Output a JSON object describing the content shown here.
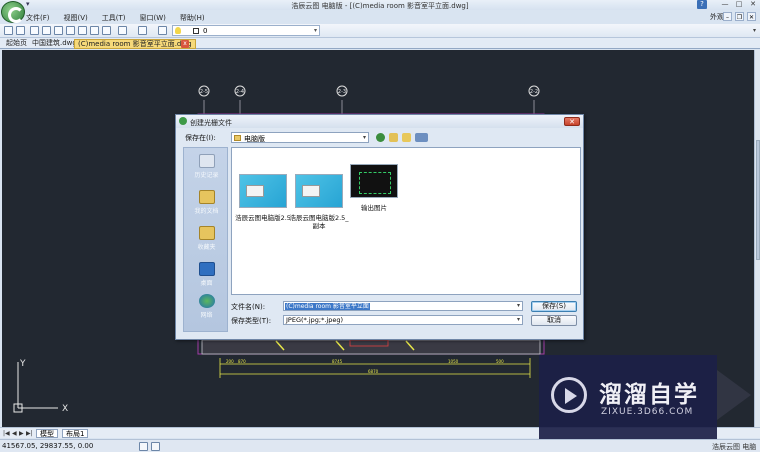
{
  "window": {
    "title": "浩辰云图 电脑版 - [(C)media room 影音室平立面.dwg]",
    "appearance": "外观",
    "help": "?",
    "minimize": "—",
    "maximize": "□",
    "close": "✕"
  },
  "menu": [
    "文件(F)",
    "视图(V)",
    "工具(T)",
    "窗口(W)",
    "帮助(H)"
  ],
  "toolbar": {
    "layer_value": "0"
  },
  "file_tabs": [
    "起始页",
    "中国建筑.dwg",
    "(C)media room 影音室平立面.dwg"
  ],
  "drawing": {
    "grid_labels": [
      "2-5",
      "2-4",
      "2-3",
      "2-2"
    ],
    "dimensions": [
      "200",
      "870",
      "8745",
      "1050",
      "500",
      "6870"
    ],
    "ucs": {
      "x": "X",
      "y": "Y"
    }
  },
  "dialog": {
    "title": "创建光栅文件",
    "save_in_label": "保存在(I):",
    "save_in_value": "电脑版",
    "places": [
      "历史记录",
      "我的文档",
      "收藏夹",
      "桌面",
      "网络"
    ],
    "files": [
      {
        "name": "浩辰云图电脑版2.5",
        "kind": "blue"
      },
      {
        "name": "浩辰云图电脑版2.5_副本",
        "kind": "blue"
      },
      {
        "name": "输出图片",
        "kind": "dark"
      }
    ],
    "filename_label": "文件名(N):",
    "filename_value": "(C)media room 影音室平立面",
    "filetype_label": "保存类型(T):",
    "filetype_value": "JPEG(*.jpg;*.jpeg)",
    "save_button": "保存(S)",
    "cancel_button": "取消"
  },
  "layout_tabs": [
    "模型",
    "布局1"
  ],
  "status": {
    "coords": "41567.05, 29837.55, 0.00",
    "right": "浩辰云图 电脑版"
  },
  "watermark": {
    "cn": "溜溜自学",
    "en": "ZIXUE.3D66.COM"
  }
}
